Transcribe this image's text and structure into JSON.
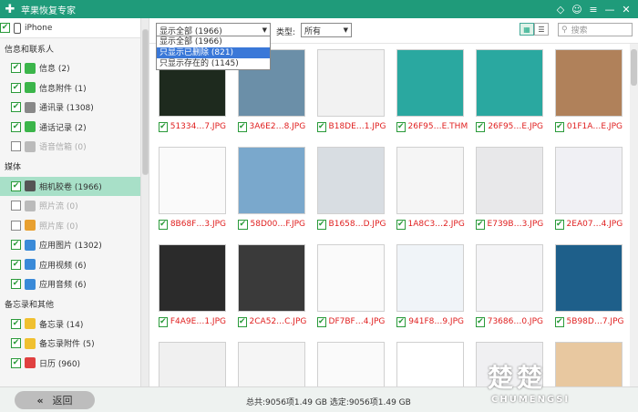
{
  "app": {
    "title": "苹果恢复专家",
    "controls": [
      "◇",
      "☺",
      "≡",
      "—",
      "✕"
    ]
  },
  "sidebar": {
    "device": "iPhone",
    "sections": [
      {
        "title": "信息和联系人",
        "items": [
          {
            "label": "信息 (2)",
            "checked": true,
            "disabled": false,
            "icon_color": "#3bb54a",
            "icon": "message-icon"
          },
          {
            "label": "信息附件 (1)",
            "checked": true,
            "disabled": false,
            "icon_color": "#3bb54a",
            "icon": "attachment-icon"
          },
          {
            "label": "通讯录 (1308)",
            "checked": true,
            "disabled": false,
            "icon_color": "#888888",
            "icon": "contacts-icon"
          },
          {
            "label": "通话记录 (2)",
            "checked": true,
            "disabled": false,
            "icon_color": "#3bb54a",
            "icon": "phone-icon"
          },
          {
            "label": "语音信箱 (0)",
            "checked": false,
            "disabled": true,
            "icon_color": "#bbbbbb",
            "icon": "voicemail-icon"
          }
        ]
      },
      {
        "title": "媒体",
        "items": [
          {
            "label": "相机胶卷 (1966)",
            "checked": true,
            "disabled": false,
            "active": true,
            "icon_color": "#555555",
            "icon": "camera-icon"
          },
          {
            "label": "照片流 (0)",
            "checked": false,
            "disabled": true,
            "icon_color": "#bbbbbb",
            "icon": "photostream-icon"
          },
          {
            "label": "照片库 (0)",
            "checked": false,
            "disabled": true,
            "icon_color": "#e8a030",
            "icon": "photos-icon"
          },
          {
            "label": "应用图片 (1302)",
            "checked": true,
            "disabled": false,
            "icon_color": "#3a8ad8",
            "icon": "app-photo-icon"
          },
          {
            "label": "应用视频 (6)",
            "checked": true,
            "disabled": false,
            "icon_color": "#3a8ad8",
            "icon": "app-video-icon"
          },
          {
            "label": "应用音频 (6)",
            "checked": true,
            "disabled": false,
            "icon_color": "#3a8ad8",
            "icon": "app-audio-icon"
          }
        ]
      },
      {
        "title": "备忘录和其他",
        "items": [
          {
            "label": "备忘录 (14)",
            "checked": true,
            "disabled": false,
            "icon_color": "#f0c030",
            "icon": "notes-icon"
          },
          {
            "label": "备忘录附件 (5)",
            "checked": true,
            "disabled": false,
            "icon_color": "#f0c030",
            "icon": "notes-attachment-icon"
          },
          {
            "label": "日历 (960)",
            "checked": true,
            "disabled": false,
            "icon_color": "#e04040",
            "icon": "calendar-icon"
          }
        ]
      }
    ]
  },
  "toolbar": {
    "filter_value": "显示全部 (1966)",
    "filter_options": [
      "显示全部 (1966)",
      "只显示已删除 (821)",
      "只显示存在的 (1145)"
    ],
    "type_label": "类型:",
    "type_value": "所有",
    "search_placeholder": "搜索"
  },
  "grid": {
    "rows": [
      [
        "51334…7.JPG",
        "3A6E2…8.JPG",
        "B18DE…1.JPG",
        "26F95…E.THM",
        "26F95…E.JPG",
        "01F1A…E.JPG"
      ],
      [
        "8B68F…3.JPG",
        "58D00…F.JPG",
        "B1658…D.JPG",
        "1A8C3…2.JPG",
        "E739B…3.JPG",
        "2EA07…4.JPG"
      ],
      [
        "F4A9E…1.JPG",
        "2CA52…C.JPG",
        "DF7BF…4.JPG",
        "941F8…9.JPG",
        "73686…0.JPG",
        "5B98D…7.JPG"
      ],
      [
        "",
        "",
        "",
        "",
        "",
        ""
      ]
    ],
    "thumb_styles": [
      [
        "#1e2a1e",
        "#6b8fa8",
        "#f2f2f2",
        "#2aa8a0",
        "#2aa8a0",
        "#b0815a"
      ],
      [
        "#fafafa",
        "#7aa8cc",
        "#d8dde2",
        "#f5f5f5",
        "#e8e8ea",
        "#f0f0f4"
      ],
      [
        "#2b2b2b",
        "#3a3a3a",
        "#fafafa",
        "#f0f4f8",
        "#f4f4f6",
        "#1e5f8a"
      ],
      [
        "#f0f0f0",
        "#f5f5f5",
        "#fafafa",
        "#ffffff",
        "#f0f0f2",
        "#e8c8a0"
      ]
    ]
  },
  "footer": {
    "back_label": "返回",
    "stats": "总共:9056项1.49 GB 选定:9056项1.49 GB"
  },
  "watermark": {
    "line1": "楚楚",
    "line2": "CHUMENGSI"
  }
}
